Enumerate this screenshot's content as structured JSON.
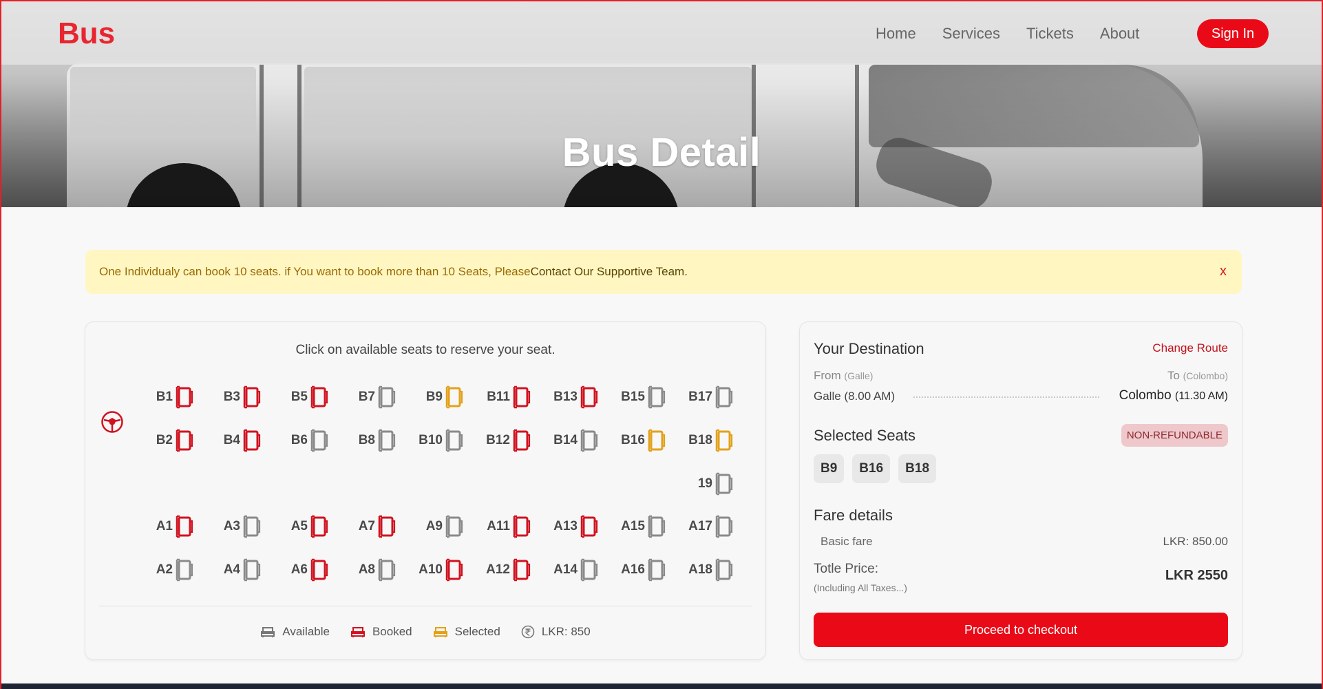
{
  "nav": {
    "brand": "Bus",
    "links": [
      "Home",
      "Services",
      "Tickets",
      "About"
    ],
    "signin": "Sign In"
  },
  "hero": {
    "title": "Bus Detail"
  },
  "alert": {
    "text": "One Individualy can book 10 seats. if You want to book more than 10 Seats, Please ",
    "link": "Contact Our Supportive Team.",
    "close": "x"
  },
  "seat_map": {
    "hint": "Click on available seats to reserve your seat.",
    "colors": {
      "available": "#8a8a8a",
      "booked": "#d01320",
      "selected": "#e3a11a"
    },
    "rows": [
      [
        [
          "B1",
          "booked"
        ],
        [
          "B3",
          "booked"
        ],
        [
          "B5",
          "booked"
        ],
        [
          "B7",
          "available"
        ],
        [
          "B9",
          "selected"
        ],
        [
          "B11",
          "booked"
        ],
        [
          "B13",
          "booked"
        ],
        [
          "B15",
          "available"
        ],
        [
          "B17",
          "available"
        ]
      ],
      [
        [
          "B2",
          "booked"
        ],
        [
          "B4",
          "booked"
        ],
        [
          "B6",
          "available"
        ],
        [
          "B8",
          "available"
        ],
        [
          "B10",
          "available"
        ],
        [
          "B12",
          "booked"
        ],
        [
          "B14",
          "available"
        ],
        [
          "B16",
          "selected"
        ],
        [
          "B18",
          "selected"
        ]
      ],
      [
        [
          null,
          null
        ],
        [
          null,
          null
        ],
        [
          null,
          null
        ],
        [
          null,
          null
        ],
        [
          null,
          null
        ],
        [
          null,
          null
        ],
        [
          null,
          null
        ],
        [
          null,
          null
        ],
        [
          "19",
          "available"
        ]
      ],
      [
        [
          "A1",
          "booked"
        ],
        [
          "A3",
          "available"
        ],
        [
          "A5",
          "booked"
        ],
        [
          "A7",
          "booked"
        ],
        [
          "A9",
          "available"
        ],
        [
          "A11",
          "booked"
        ],
        [
          "A13",
          "booked"
        ],
        [
          "A15",
          "available"
        ],
        [
          "A17",
          "available"
        ]
      ],
      [
        [
          "A2",
          "available"
        ],
        [
          "A4",
          "available"
        ],
        [
          "A6",
          "booked"
        ],
        [
          "A8",
          "available"
        ],
        [
          "A10",
          "booked"
        ],
        [
          "A12",
          "booked"
        ],
        [
          "A14",
          "available"
        ],
        [
          "A16",
          "available"
        ],
        [
          "A18",
          "available"
        ]
      ]
    ],
    "legend": {
      "available": "Available",
      "booked": "Booked",
      "selected": "Selected",
      "price": "LKR: 850"
    }
  },
  "destination": {
    "title": "Your Destination",
    "change_route": "Change Route",
    "from_label": "From",
    "from_city": "(Galle)",
    "to_label": "To",
    "to_city": "(Colombo)",
    "from_time": "Galle (8.00 AM)",
    "to_place": "Colombo",
    "to_time": "(11.30 AM)",
    "selected_title": "Selected Seats",
    "badge": "NON-REFUNDABLE",
    "selected_seats": [
      "B9",
      "B16",
      "B18"
    ],
    "fare_title": "Fare details",
    "basic_label": "Basic fare",
    "basic_value": "LKR: 850.00",
    "total_label": "Totle Price:",
    "total_note": "(Including All Taxes...)",
    "total_value": "LKR 2550",
    "checkout": "Proceed to checkout"
  }
}
